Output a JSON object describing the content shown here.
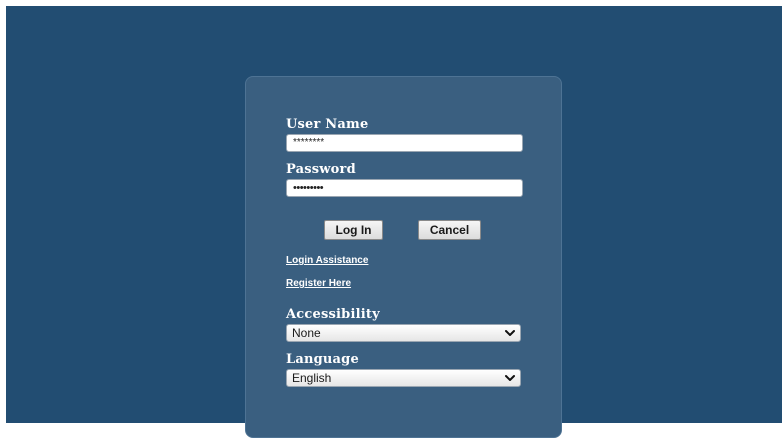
{
  "login": {
    "username_label": "User Name",
    "username_value": "********",
    "password_label": "Password",
    "password_value": "•••••••••",
    "login_button": "Log In",
    "cancel_button": "Cancel",
    "assistance_link": "Login Assistance",
    "register_link": "Register Here"
  },
  "accessibility": {
    "label": "Accessibility",
    "selected": "None"
  },
  "language": {
    "label": "Language",
    "selected": "English"
  },
  "colors": {
    "background": "#224d72",
    "panel": "#3a5f80"
  },
  "icons": {
    "dropdown": "chevron-down-icon"
  }
}
